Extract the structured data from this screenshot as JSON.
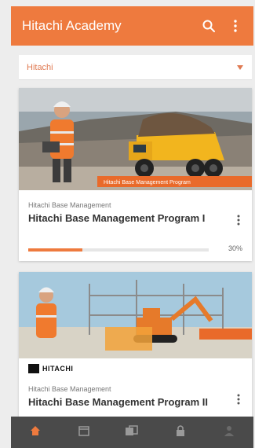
{
  "app": {
    "title": "Hitachi Academy"
  },
  "filter": {
    "value": "Hitachi"
  },
  "courses": [
    {
      "banner_caption": "Hitachi Base Management Program",
      "tagline": "Hitachi Base Management",
      "title": "Hitachi Base Management Program I",
      "progress_percent": 30,
      "progress_label": "30%"
    },
    {
      "sponsor": "HITACHI",
      "tagline": "Hitachi Base Management",
      "title": "Hitachi Base Management Program II"
    }
  ],
  "colors": {
    "accent": "#ee7a3e",
    "nav_bg": "#4a4a4a",
    "background": "#ededed"
  },
  "bottom_nav": [
    {
      "icon": "home-icon",
      "active": true
    },
    {
      "icon": "calendar-icon",
      "active": false
    },
    {
      "icon": "courses-icon",
      "active": false
    },
    {
      "icon": "lock-icon",
      "active": false
    },
    {
      "icon": "profile-icon",
      "active": false
    }
  ]
}
